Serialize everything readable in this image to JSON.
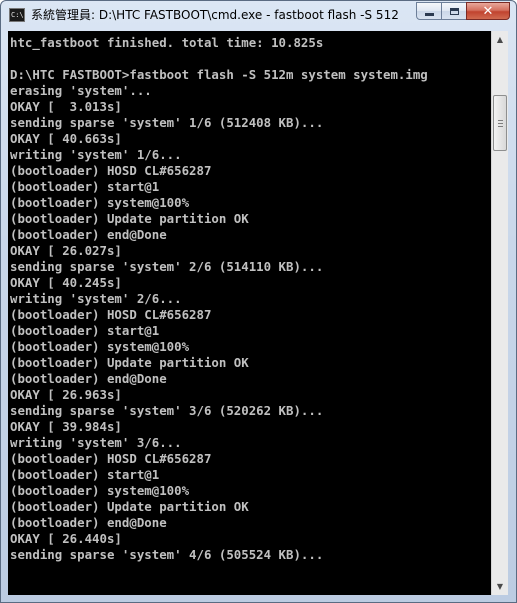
{
  "window": {
    "title": "系統管理員: D:\\HTC FASTBOOT\\cmd.exe - fastboot  flash -S 512...",
    "icon_text": "C:\\",
    "buttons": [
      "minimize",
      "maximize",
      "close"
    ]
  },
  "console": {
    "lines": [
      "htc_fastboot finished. total time: 10.825s",
      "",
      "D:\\HTC FASTBOOT>fastboot flash -S 512m system system.img",
      "erasing 'system'...",
      "OKAY [  3.013s]",
      "sending sparse 'system' 1/6 (512408 KB)...",
      "OKAY [ 40.663s]",
      "writing 'system' 1/6...",
      "(bootloader) HOSD CL#656287",
      "(bootloader) start@1",
      "(bootloader) system@100%",
      "(bootloader) Update partition OK",
      "(bootloader) end@Done",
      "OKAY [ 26.027s]",
      "sending sparse 'system' 2/6 (514110 KB)...",
      "OKAY [ 40.245s]",
      "writing 'system' 2/6...",
      "(bootloader) HOSD CL#656287",
      "(bootloader) start@1",
      "(bootloader) system@100%",
      "(bootloader) Update partition OK",
      "(bootloader) end@Done",
      "OKAY [ 26.963s]",
      "sending sparse 'system' 3/6 (520262 KB)...",
      "OKAY [ 39.984s]",
      "writing 'system' 3/6...",
      "(bootloader) HOSD CL#656287",
      "(bootloader) start@1",
      "(bootloader) system@100%",
      "(bootloader) Update partition OK",
      "(bootloader) end@Done",
      "OKAY [ 26.440s]",
      "sending sparse 'system' 4/6 (505524 KB)..."
    ]
  },
  "scrollbar": {
    "up_arrow_icon": "triangle-up-icon",
    "down_arrow_icon": "triangle-down-icon",
    "position_fraction": 0.1
  },
  "colors": {
    "console_background": "#000000",
    "console_text": "#c0c0c0",
    "close_button": "#c1432f"
  }
}
